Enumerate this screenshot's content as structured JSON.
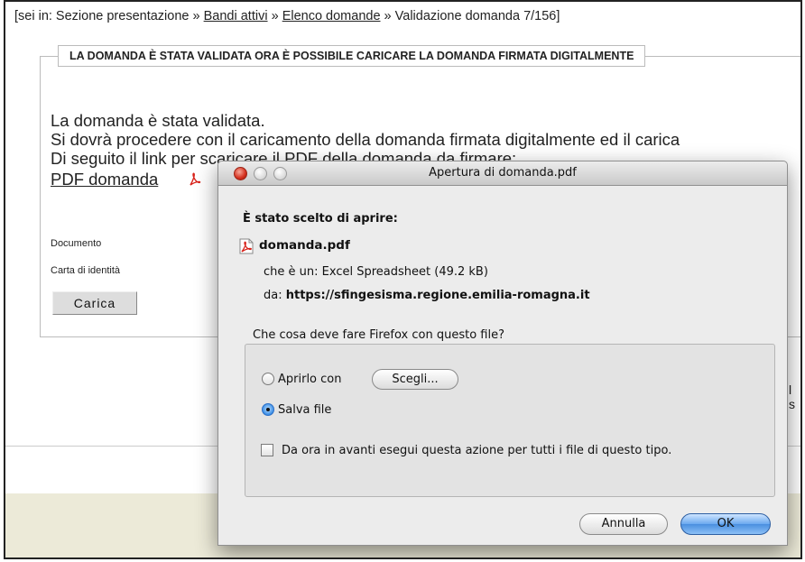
{
  "breadcrumb": {
    "prefix": "[sei in: Sezione presentazione",
    "sep1": "»",
    "link1": "Bandi attivi",
    "sep2": "»",
    "link2": "Elenco domande",
    "sep3": "»",
    "current": "Validazione domanda 7/156]"
  },
  "banner": "LA DOMANDA È STATA VALIDATA ORA È POSSIBILE CARICARE LA DOMANDA FIRMATA DIGITALMENTE",
  "messages": [
    "La domanda è stata validata.",
    "Si dovrà procedere con il caricamento della domanda firmata digitalmente ed il carica",
    "Di seguito il link per scaricare il PDF della domanda da firmare:"
  ],
  "pdf_link": "PDF domanda",
  "fields": {
    "documento": "Documento",
    "carta": "Carta di identità"
  },
  "carica_button": "Carica",
  "edge_text": "l s",
  "dialog": {
    "title": "Apertura di domanda.pdf",
    "heading": "È stato scelto di aprire:",
    "filename": "domanda.pdf",
    "type_label": "che è un:",
    "type_value": "Excel Spreadsheet (49.2 kB)",
    "from_label": "da:",
    "from_value": "https://sfingesisma.regione.emilia-romagna.it",
    "question": "Che cosa deve fare Firefox con questo file?",
    "open_with_label": "Aprirlo con",
    "choose_button": "Scegli...",
    "save_label": "Salva file",
    "selected_option": "Salva file",
    "remember_label": "Da ora in avanti esegui questa azione per tutti i file di questo tipo.",
    "remember_checked": false,
    "cancel_button": "Annulla",
    "ok_button": "OK"
  },
  "colors": {
    "pdf_red": "#d8231b",
    "close_red": "#d42f1d",
    "ok_blue": "#4a8fe0",
    "footer_beige": "#ecead8"
  },
  "icons": [
    "pdf-icon",
    "close-window-icon",
    "minimize-window-icon",
    "zoom-window-icon"
  ]
}
